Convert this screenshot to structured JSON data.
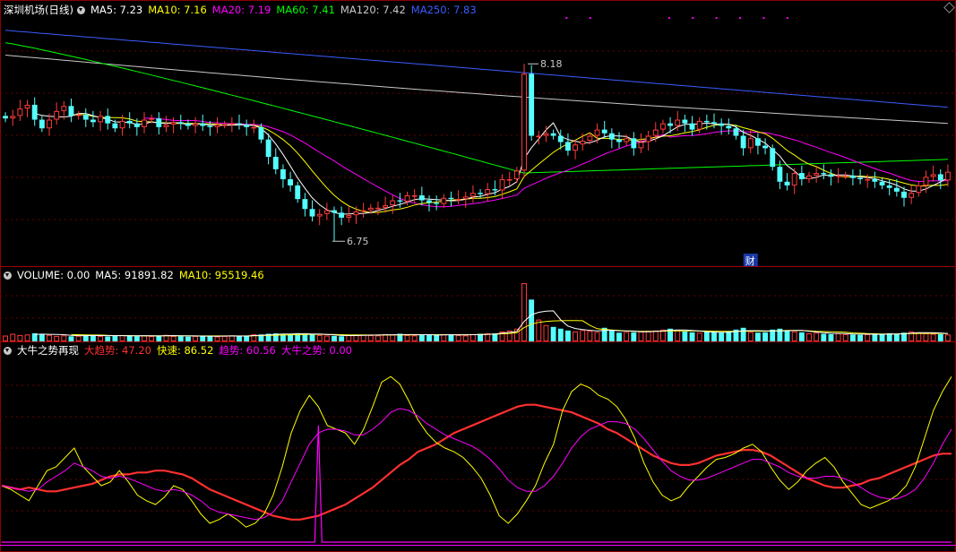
{
  "header_main": {
    "title": "深圳机场(日线)",
    "items": [
      {
        "label": "MA5: 7.23",
        "color": "#ffffff"
      },
      {
        "label": "MA10: 7.16",
        "color": "#ffff00"
      },
      {
        "label": "MA20: 7.19",
        "color": "#ff00ff"
      },
      {
        "label": "MA60: 7.41",
        "color": "#00ff00"
      },
      {
        "label": "MA120: 7.42",
        "color": "#c8c8c8"
      },
      {
        "label": "MA250: 7.83",
        "color": "#3a5cff"
      }
    ]
  },
  "header_volume": {
    "items": [
      {
        "label": "VOLUME: 0.00",
        "color": "#ffffff"
      },
      {
        "label": "MA5: 91891.82",
        "color": "#ffffff"
      },
      {
        "label": "MA10: 95519.46",
        "color": "#ffff00"
      }
    ]
  },
  "header_indicator": {
    "items": [
      {
        "label": "大牛之势再现",
        "color": "#ffffff"
      },
      {
        "label": "大趋势: 47.20",
        "color": "#ff3030"
      },
      {
        "label": "快速: 86.52",
        "color": "#ffff00"
      },
      {
        "label": "趋势: 60.56",
        "color": "#ff00ff"
      },
      {
        "label": "大牛之势: 0.00",
        "color": "#ff00ff"
      }
    ]
  },
  "annotations": {
    "high_label": "8.18",
    "low_label": "6.75",
    "cai_label": "财"
  },
  "chart_data": [
    {
      "type": "candlestick",
      "ylim": [
        6.6,
        8.55
      ],
      "high": 8.18,
      "low": 6.75,
      "closes": [
        7.74,
        7.76,
        7.82,
        7.85,
        7.73,
        7.66,
        7.73,
        7.8,
        7.84,
        7.76,
        7.77,
        7.73,
        7.71,
        7.76,
        7.7,
        7.66,
        7.72,
        7.7,
        7.67,
        7.73,
        7.74,
        7.67,
        7.69,
        7.71,
        7.7,
        7.68,
        7.7,
        7.68,
        7.67,
        7.69,
        7.69,
        7.7,
        7.69,
        7.67,
        7.67,
        7.57,
        7.43,
        7.33,
        7.25,
        7.2,
        7.09,
        7.01,
        6.95,
        6.97,
        7.0,
        6.98,
        6.94,
        6.96,
        6.99,
        7.0,
        7.02,
        7.02,
        7.04,
        7.08,
        7.07,
        7.12,
        7.12,
        7.08,
        7.06,
        7.05,
        7.1,
        7.09,
        7.09,
        7.11,
        7.14,
        7.13,
        7.17,
        7.16,
        7.25,
        7.25,
        7.32,
        8.1,
        7.6,
        7.6,
        7.62,
        7.6,
        7.55,
        7.48,
        7.53,
        7.56,
        7.6,
        7.65,
        7.62,
        7.57,
        7.55,
        7.58,
        7.5,
        7.55,
        7.6,
        7.65,
        7.7,
        7.68,
        7.73,
        7.7,
        7.65,
        7.72,
        7.71,
        7.7,
        7.68,
        7.66,
        7.6,
        7.5,
        7.58,
        7.52,
        7.5,
        7.35,
        7.23,
        7.2,
        7.3,
        7.25,
        7.28,
        7.3,
        7.29,
        7.27,
        7.28,
        7.28,
        7.26,
        7.25,
        7.25,
        7.23,
        7.2,
        7.18,
        7.15,
        7.1,
        7.14,
        7.2,
        7.27,
        7.29,
        7.24,
        7.31
      ]
    },
    {
      "type": "bar",
      "ylim": [
        0,
        330000
      ],
      "values": [
        32000,
        42000,
        35000,
        38000,
        45000,
        40000,
        36000,
        30000,
        33000,
        28000,
        31000,
        36000,
        34000,
        30000,
        27000,
        32000,
        35000,
        30000,
        28000,
        33000,
        29000,
        31000,
        36000,
        30000,
        28000,
        26000,
        30000,
        32000,
        29000,
        27000,
        30000,
        33000,
        28000,
        30000,
        40000,
        38000,
        42000,
        44000,
        39000,
        41000,
        45000,
        43000,
        37000,
        35000,
        32000,
        30000,
        28000,
        34000,
        36000,
        38000,
        35000,
        33000,
        40000,
        37000,
        42000,
        35000,
        33000,
        38000,
        36000,
        34000,
        39000,
        37000,
        35000,
        33000,
        40000,
        42000,
        45000,
        44000,
        55000,
        60000,
        70000,
        320000,
        230000,
        120000,
        90000,
        80000,
        70000,
        60000,
        55000,
        62000,
        58000,
        52000,
        75000,
        60000,
        48000,
        52000,
        50000,
        55000,
        58000,
        60000,
        65000,
        70000,
        62000,
        55000,
        50000,
        48000,
        52000,
        50000,
        48000,
        55000,
        65000,
        75000,
        52000,
        48000,
        50000,
        65000,
        70000,
        60000,
        55000,
        50000,
        45000,
        48000,
        42000,
        40000,
        45000,
        40000,
        38000,
        36000,
        40000,
        42000,
        38000,
        45000,
        40000,
        48000,
        55000,
        50000,
        45000,
        42000,
        40000,
        38000
      ],
      "ma10_values": [
        null,
        null,
        null,
        null,
        null,
        null,
        null,
        null,
        null,
        37000,
        37000,
        36000,
        35000,
        35000,
        33000,
        32000,
        32000,
        32000,
        31000,
        31000,
        31000,
        31000,
        31000,
        31000,
        31000,
        31000,
        30000,
        30000,
        30000,
        30000,
        30000,
        30000,
        30000,
        30000,
        31000,
        32000,
        33000,
        34000,
        35000,
        36000,
        37000,
        38000,
        39000,
        39000,
        38000,
        38000,
        37000,
        36000,
        36000,
        35000,
        35000,
        35000,
        35000,
        36000,
        36000,
        36000,
        36000,
        37000,
        37000,
        37000,
        37000,
        37000,
        37000,
        37000,
        37000,
        38000,
        39000,
        40000,
        42000,
        44000,
        48000,
        76000,
        95000,
        105000,
        110000,
        113000,
        114000,
        115000,
        115000,
        114000,
        88000,
        70000,
        66000,
        63000,
        60000,
        57000,
        55000,
        55000,
        55000,
        55000,
        56000,
        58000,
        58000,
        58000,
        58000,
        57000,
        57000,
        56000,
        55000,
        55000,
        55000,
        56000,
        56000,
        56000,
        56000,
        57000,
        59000,
        60000,
        60000,
        60000,
        58000,
        55000,
        54000,
        53000,
        52000,
        50000,
        47000,
        45000,
        43000,
        42000,
        41000,
        41000,
        41000,
        42000,
        43000,
        44000,
        44000,
        44000,
        44000,
        43000
      ]
    },
    {
      "type": "line",
      "ylim": [
        0,
        100
      ],
      "series": [
        {
          "name": "大趋势",
          "color": "#ff3030",
          "values": [
            30,
            29,
            28,
            29,
            28,
            27,
            27,
            28,
            29,
            30,
            31,
            33,
            35,
            36,
            36,
            37,
            37,
            38,
            38,
            37,
            36,
            34,
            31,
            28,
            26,
            24,
            22,
            20,
            18,
            16,
            14,
            13,
            12,
            12,
            13,
            14,
            16,
            18,
            20,
            23,
            26,
            29,
            33,
            37,
            41,
            44,
            48,
            50,
            52,
            55,
            58,
            60,
            62,
            64,
            66,
            68,
            70,
            72,
            73,
            73,
            72,
            71,
            70,
            69,
            67,
            65,
            63,
            60,
            58,
            55,
            52,
            49,
            46,
            44,
            42,
            41,
            41,
            42,
            44,
            46,
            47,
            48,
            49,
            49,
            48,
            46,
            43,
            40,
            37,
            34,
            32,
            30,
            29,
            29,
            30,
            31,
            33,
            34,
            36,
            38,
            40,
            42,
            44,
            46,
            47,
            47
          ]
        },
        {
          "name": "快速",
          "color": "#ffff00",
          "values": [
            30,
            28,
            25,
            22,
            30,
            38,
            40,
            45,
            50,
            40,
            35,
            30,
            32,
            38,
            32,
            25,
            22,
            20,
            24,
            30,
            28,
            22,
            15,
            10,
            12,
            15,
            12,
            8,
            10,
            15,
            25,
            40,
            58,
            70,
            78,
            72,
            62,
            60,
            58,
            52,
            60,
            72,
            85,
            88,
            84,
            75,
            65,
            58,
            53,
            50,
            48,
            45,
            40,
            34,
            25,
            14,
            10,
            15,
            22,
            30,
            42,
            52,
            70,
            80,
            84,
            82,
            78,
            76,
            72,
            65,
            55,
            42,
            32,
            25,
            22,
            24,
            30,
            35,
            40,
            44,
            45,
            47,
            50,
            52,
            48,
            40,
            33,
            28,
            32,
            38,
            42,
            45,
            40,
            32,
            26,
            20,
            18,
            20,
            22,
            25,
            30,
            40,
            55,
            70,
            80,
            88
          ]
        },
        {
          "name": "趋势",
          "color": "#ff00ff",
          "values": [
            30,
            29,
            28,
            27,
            28,
            32,
            35,
            38,
            42,
            40,
            38,
            35,
            34,
            35,
            34,
            32,
            30,
            28,
            27,
            28,
            27,
            25,
            22,
            18,
            16,
            15,
            14,
            13,
            12,
            13,
            16,
            22,
            32,
            42,
            52,
            58,
            60,
            60,
            59,
            57,
            57,
            60,
            64,
            69,
            71,
            70,
            67,
            63,
            60,
            57,
            55,
            53,
            51,
            48,
            44,
            39,
            33,
            29,
            27,
            27,
            30,
            35,
            42,
            50,
            56,
            60,
            62,
            64,
            64,
            63,
            60,
            55,
            49,
            43,
            38,
            35,
            33,
            33,
            34,
            36,
            38,
            40,
            42,
            44,
            44,
            42,
            40,
            37,
            35,
            34,
            34,
            35,
            35,
            34,
            32,
            29,
            26,
            24,
            23,
            23,
            25,
            28,
            34,
            42,
            52,
            60
          ]
        },
        {
          "name": "大牛之势",
          "color": "#ff00ff",
          "values": [
            0,
            0,
            0,
            0,
            0,
            0,
            0,
            0,
            0,
            0,
            0,
            0,
            0,
            0,
            0,
            0,
            0,
            0,
            0,
            0,
            0,
            0,
            0,
            0,
            0,
            0,
            0,
            0,
            0,
            0,
            0,
            0,
            0,
            0,
            0,
            0,
            0,
            0,
            0,
            0,
            0,
            0,
            0,
            0,
            0,
            0,
            0,
            0,
            0,
            0,
            0,
            0,
            0,
            0,
            0,
            0,
            0,
            0,
            0,
            0,
            0,
            0,
            0,
            0,
            0,
            0,
            0,
            0,
            0,
            0,
            0,
            0,
            0,
            0,
            0,
            0,
            0,
            0,
            0,
            0,
            0,
            0,
            0,
            0,
            0,
            0,
            0,
            0,
            0,
            0,
            0,
            0,
            0,
            0,
            0,
            0,
            0,
            0,
            0,
            0,
            0,
            0,
            0,
            0,
            0,
            0
          ]
        }
      ],
      "spike_index": 35,
      "spike_value": 62
    }
  ]
}
